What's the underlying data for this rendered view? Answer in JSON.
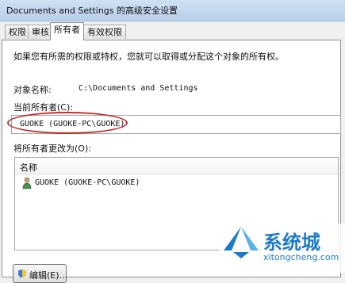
{
  "window": {
    "title": "Documents and Settings 的高级安全设置"
  },
  "tabs": [
    {
      "label": "权限",
      "active": false
    },
    {
      "label": "审核",
      "active": false
    },
    {
      "label": "所有者",
      "active": true
    },
    {
      "label": "有效权限",
      "active": false
    }
  ],
  "panel": {
    "instruction": "如果您有所需的权限或特权，您就可以取得或分配这个对象的所有权。",
    "object_name_label": "对象名称:",
    "object_name_value": "C:\\Documents and Settings",
    "current_owner_label": "当前所有者(C):",
    "current_owner_value": "GUOKE (GUOKE-PC\\GUOKE)",
    "change_owner_label": "将所有者更改为(O):",
    "owner_list": {
      "column_header": "名称",
      "items": [
        {
          "name": "GUOKE (GUOKE-PC\\GUOKE)",
          "icon": "user-icon"
        }
      ]
    },
    "edit_button_label": "编辑(E)..."
  },
  "watermark": {
    "brand": "系统城",
    "url": "xitongcheng.com"
  },
  "colors": {
    "highlight_ellipse": "#c52a2a",
    "watermark_blue": "#1d7ac8"
  }
}
